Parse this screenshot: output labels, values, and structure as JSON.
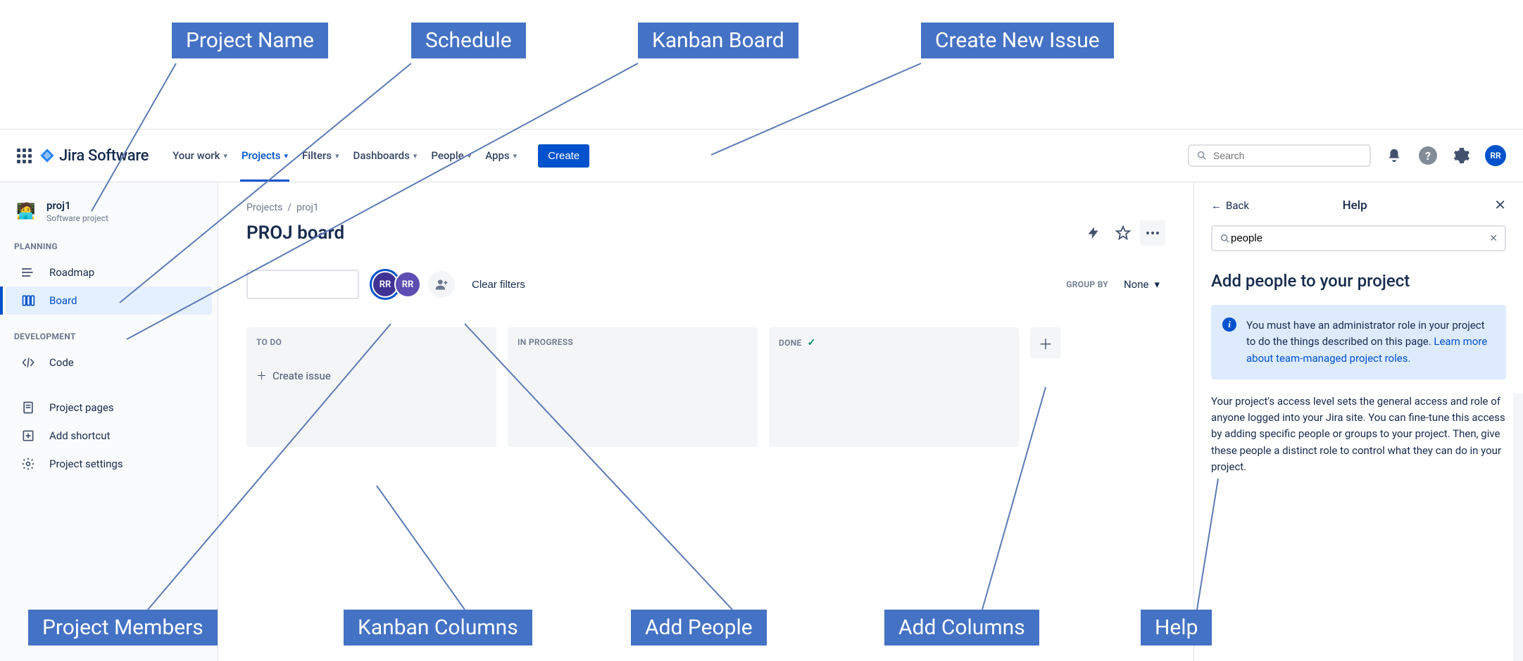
{
  "callouts": {
    "project_name": "Project Name",
    "schedule": "Schedule",
    "kanban_board": "Kanban Board",
    "create_new_issue": "Create New Issue",
    "project_members": "Project Members",
    "kanban_columns": "Kanban Columns",
    "add_people": "Add People",
    "add_columns": "Add Columns",
    "help": "Help"
  },
  "topnav": {
    "logo": "Jira Software",
    "items": [
      {
        "label": "Your work"
      },
      {
        "label": "Projects",
        "active": true
      },
      {
        "label": "Filters"
      },
      {
        "label": "Dashboards"
      },
      {
        "label": "People"
      },
      {
        "label": "Apps"
      }
    ],
    "create": "Create",
    "search_placeholder": "Search",
    "avatar": "RR"
  },
  "sidebar": {
    "project_name": "proj1",
    "project_type": "Software project",
    "sections": {
      "planning": "PLANNING",
      "development": "DEVELOPMENT"
    },
    "items": {
      "roadmap": "Roadmap",
      "board": "Board",
      "code": "Code",
      "project_pages": "Project pages",
      "add_shortcut": "Add shortcut",
      "project_settings": "Project settings"
    }
  },
  "main": {
    "breadcrumb_projects": "Projects",
    "breadcrumb_project": "proj1",
    "title": "PROJ board",
    "groupby_label": "GROUP BY",
    "groupby_value": "None",
    "clear_filters": "Clear filters",
    "avatars": [
      "RR",
      "RR"
    ],
    "columns": [
      {
        "title": "TO DO",
        "create": true
      },
      {
        "title": "IN PROGRESS"
      },
      {
        "title": "DONE",
        "done": true
      }
    ],
    "create_issue": "Create issue"
  },
  "help": {
    "back": "Back",
    "title": "Help",
    "search_value": "people",
    "heading": "Add people to your project",
    "info_text": "You must have an administrator role in your project to do the things described on this page. ",
    "info_link": "Learn more about team-managed project roles.",
    "body": "Your project's access level sets the general access and role of anyone logged into your Jira site. You can fine-tune this access by adding specific people or groups to your project. Then, give these people a distinct role to control what they can do in your project."
  }
}
